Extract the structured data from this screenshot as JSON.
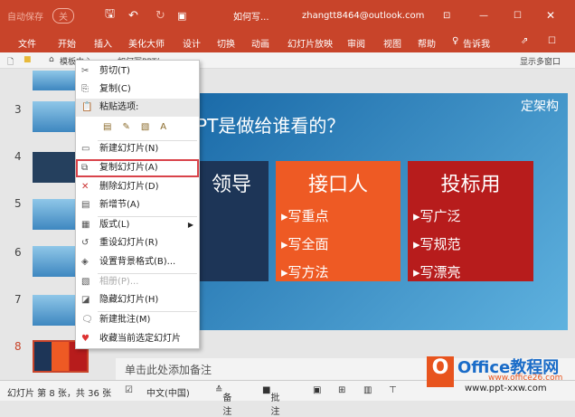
{
  "titlebar": {
    "autosave": "自动保存",
    "autosave_state": "关",
    "doc": "如何写...",
    "account": "zhangtt8464@outlook.com"
  },
  "ribbon": [
    "文件",
    "开始",
    "插入",
    "美化大师",
    "设计",
    "切换",
    "动画",
    "幻灯片放映",
    "审阅",
    "视图",
    "帮助",
    "告诉我"
  ],
  "tabs": {
    "t1": "模板中心",
    "t2": "如何写PPT(...",
    "show_windows": "显示多窗口"
  },
  "slide_numbers": [
    "3",
    "4",
    "5",
    "6",
    "7",
    "8"
  ],
  "slide": {
    "title": "PPT是做给谁看的？",
    "corner": "定架构",
    "columns": [
      {
        "head": "领导",
        "items": [],
        "color": "#1d3557"
      },
      {
        "head": "接口人",
        "items": [
          "▸写重点",
          "▸写全面",
          "▸写方法"
        ],
        "color": "#ee5a24"
      },
      {
        "head": "投标用",
        "items": [
          "▸写广泛",
          "▸写规范",
          "▸写漂亮"
        ],
        "color": "#b71c1c"
      }
    ]
  },
  "menu": {
    "cut": "剪切(T)",
    "copy": "复制(C)",
    "paste_options": "粘贴选项:",
    "new_slide": "新建幻灯片(N)",
    "dup_slide": "复制幻灯片(A)",
    "del_slide": "删除幻灯片(D)",
    "new_section": "新增节(A)",
    "layout": "版式(L)",
    "reset": "重设幻灯片(R)",
    "bg": "设置背景格式(B)...",
    "album": "相册(P)...",
    "hide": "隐藏幻灯片(H)",
    "comment": "新建批注(M)",
    "fav": "收藏当前选定幻灯片"
  },
  "notes_placeholder": "单击此处添加备注",
  "status": {
    "slide_info": "幻灯片 第 8 张，共 36 张",
    "lang": "中文(中国)",
    "notes": "备注",
    "comments": "批注"
  },
  "watermark": {
    "brand": "Office教程网",
    "url1": "www.office26.com",
    "url2": "www.ppt-xxw.com"
  }
}
